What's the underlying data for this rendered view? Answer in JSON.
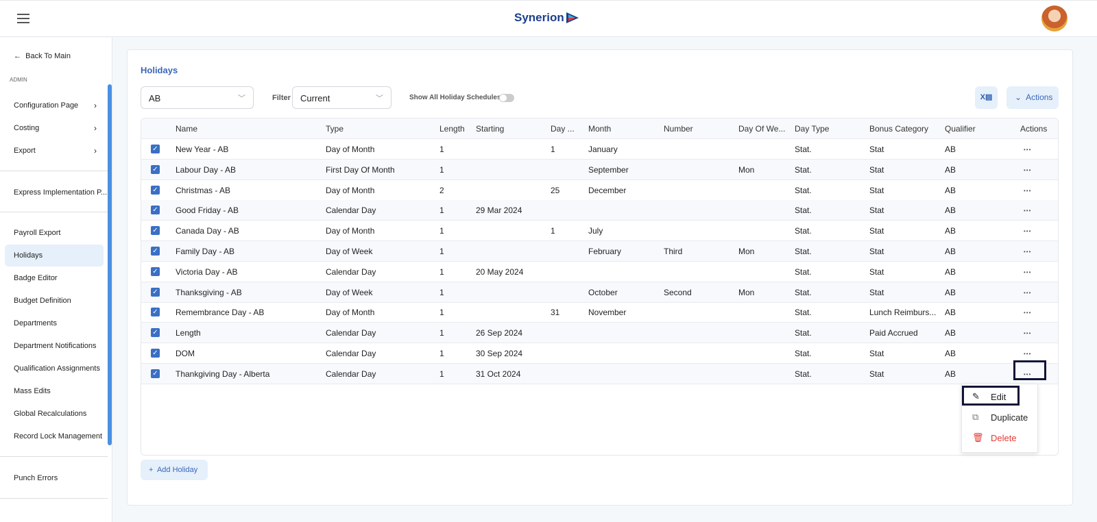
{
  "header": {
    "brand": "Synerion",
    "menu_icon": "hamburger-icon"
  },
  "sidebar": {
    "back": "Back To Main",
    "section": "ADMIN",
    "groups": [
      {
        "label": "Configuration Page"
      },
      {
        "label": "Costing"
      },
      {
        "label": "Export"
      }
    ],
    "items": [
      "Express Implementation P...",
      "Payroll Export",
      "Holidays",
      "Badge Editor",
      "Budget Definition",
      "Departments",
      "Department Notifications",
      "Qualification Assignments",
      "Mass Edits",
      "Global Recalculations",
      "Record Lock Management",
      "Punch Errors"
    ],
    "active": "Holidays"
  },
  "page": {
    "title": "Holidays",
    "schedule_value": "AB",
    "filter_label": "Filter",
    "filter_value": "Current",
    "toggle_label": "Show All Holiday Schedules",
    "toggle_on": false,
    "export_icon": "excel-icon",
    "actions_label": "Actions",
    "add_label": "Add Holiday"
  },
  "table": {
    "columns": [
      "Name",
      "Type",
      "Length",
      "Starting",
      "Day ...",
      "Month",
      "Number",
      "Day Of We...",
      "Day Type",
      "Bonus Category",
      "Qualifier",
      "Actions"
    ],
    "rows": [
      [
        "New Year - AB",
        "Day of Month",
        "1",
        "",
        "1",
        "January",
        "",
        "",
        "Stat.",
        "Stat",
        "AB"
      ],
      [
        "Labour Day - AB",
        "First Day Of Month",
        "1",
        "",
        "",
        "September",
        "",
        "Mon",
        "Stat.",
        "Stat",
        "AB"
      ],
      [
        "Christmas - AB",
        "Day of Month",
        "2",
        "",
        "25",
        "December",
        "",
        "",
        "Stat.",
        "Stat",
        "AB"
      ],
      [
        "Good Friday - AB",
        "Calendar Day",
        "1",
        "29 Mar 2024",
        "",
        "",
        "",
        "",
        "Stat.",
        "Stat",
        "AB"
      ],
      [
        "Canada Day - AB",
        "Day of Month",
        "1",
        "",
        "1",
        "July",
        "",
        "",
        "Stat.",
        "Stat",
        "AB"
      ],
      [
        "Family Day - AB",
        "Day of Week",
        "1",
        "",
        "",
        "February",
        "Third",
        "Mon",
        "Stat.",
        "Stat",
        "AB"
      ],
      [
        "Victoria Day - AB",
        "Calendar Day",
        "1",
        "20 May 2024",
        "",
        "",
        "",
        "",
        "Stat.",
        "Stat",
        "AB"
      ],
      [
        "Thanksgiving - AB",
        "Day of Week",
        "1",
        "",
        "",
        "October",
        "Second",
        "Mon",
        "Stat.",
        "Stat",
        "AB"
      ],
      [
        "Remembrance Day - AB",
        "Day of Month",
        "1",
        "",
        "31",
        "November",
        "",
        "",
        "Stat.",
        "Lunch Reimburs...",
        "AB"
      ],
      [
        "Length",
        "Calendar Day",
        "1",
        "26 Sep 2024",
        "",
        "",
        "",
        "",
        "Stat.",
        "Paid Accrued",
        "AB"
      ],
      [
        "DOM",
        "Calendar Day",
        "1",
        "30 Sep 2024",
        "",
        "",
        "",
        "",
        "Stat.",
        "Stat",
        "AB"
      ],
      [
        "Thankgiving Day - Alberta",
        "Calendar Day",
        "1",
        "31 Oct 2024",
        "",
        "",
        "",
        "",
        "Stat.",
        "Stat",
        "AB"
      ]
    ],
    "all_checked": true
  },
  "context_menu": {
    "items": [
      {
        "label": "Edit",
        "icon": "pencil-icon"
      },
      {
        "label": "Duplicate",
        "icon": "copy-icon"
      },
      {
        "label": "Delete",
        "icon": "trash-icon",
        "color": "#e53935"
      }
    ]
  }
}
